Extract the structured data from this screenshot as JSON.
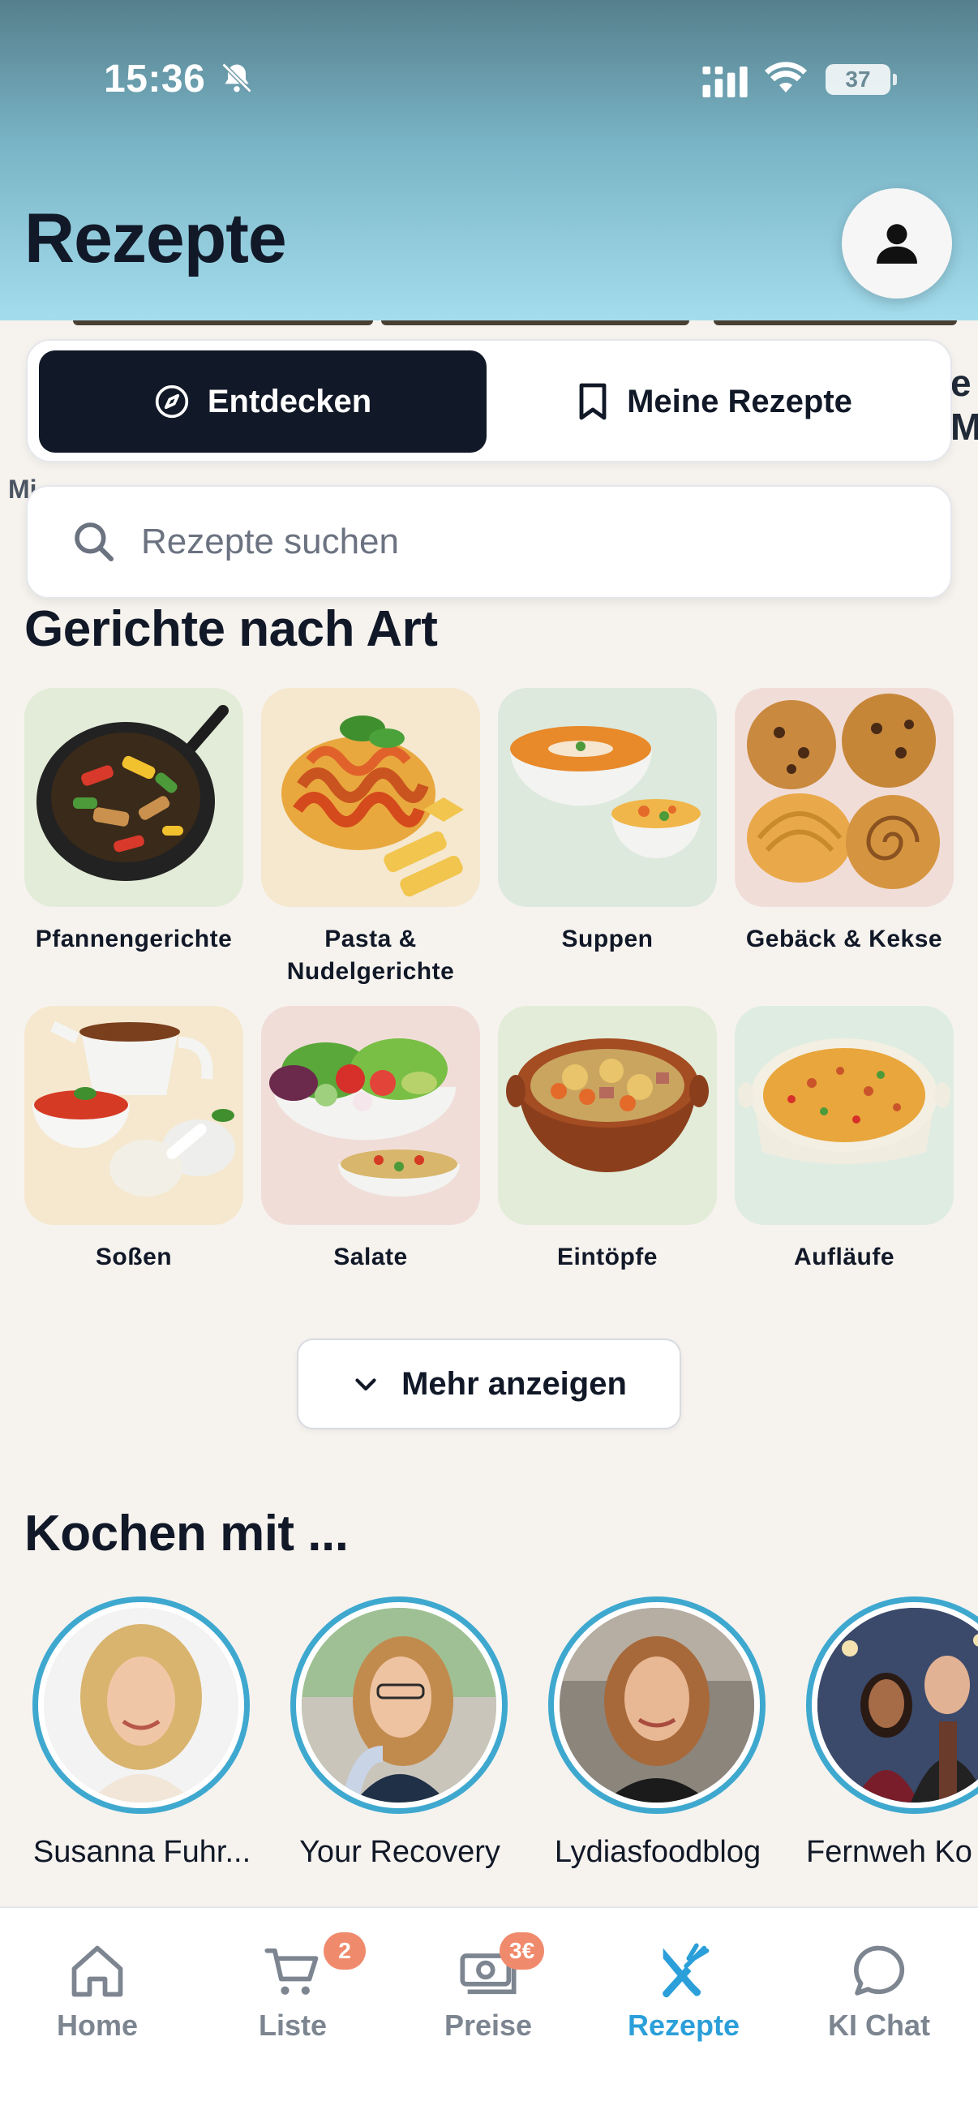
{
  "status_bar": {
    "time": "15:36",
    "battery": "37"
  },
  "header": {
    "title": "Rezepte"
  },
  "segments": {
    "discover": "Entdecken",
    "my_recipes": "Meine Rezepte"
  },
  "peek": {
    "left_text": "Mi",
    "right_text_1": "e",
    "right_text_2": "M"
  },
  "search": {
    "placeholder": "Rezepte suchen"
  },
  "categories": {
    "title": "Gerichte nach Art",
    "items": [
      {
        "label": "Pfannengerichte",
        "bg": "#e3ecd8"
      },
      {
        "label": "Pasta & Nudelgerichte",
        "bg": "#f5e8cf"
      },
      {
        "label": "Suppen",
        "bg": "#dde9dc"
      },
      {
        "label": "Gebäck & Kekse",
        "bg": "#f1ddd8"
      },
      {
        "label": "Soßen",
        "bg": "#f5e8cf"
      },
      {
        "label": "Salate",
        "bg": "#f1ddd8"
      },
      {
        "label": "Eintöpfe",
        "bg": "#e3ecd8"
      },
      {
        "label": "Aufläufe",
        "bg": "#dfece2"
      }
    ],
    "more_label": "Mehr anzeigen"
  },
  "creators": {
    "title": "Kochen mit ...",
    "items": [
      {
        "name": "Susanna Fuhr..."
      },
      {
        "name": "Your Recovery"
      },
      {
        "name": "Lydiasfoodblog"
      },
      {
        "name": "Fernweh Ko"
      }
    ]
  },
  "tabbar": {
    "items": [
      {
        "label": "Home",
        "icon": "home-icon",
        "badge": ""
      },
      {
        "label": "Liste",
        "icon": "cart-icon",
        "badge": "2"
      },
      {
        "label": "Preise",
        "icon": "price-icon",
        "badge": "3€"
      },
      {
        "label": "Rezepte",
        "icon": "cutlery-icon",
        "badge": ""
      },
      {
        "label": "KI Chat",
        "icon": "chat-icon",
        "badge": ""
      }
    ],
    "active_color": "#2b9fd9",
    "badge_color": "#f08a6c"
  }
}
